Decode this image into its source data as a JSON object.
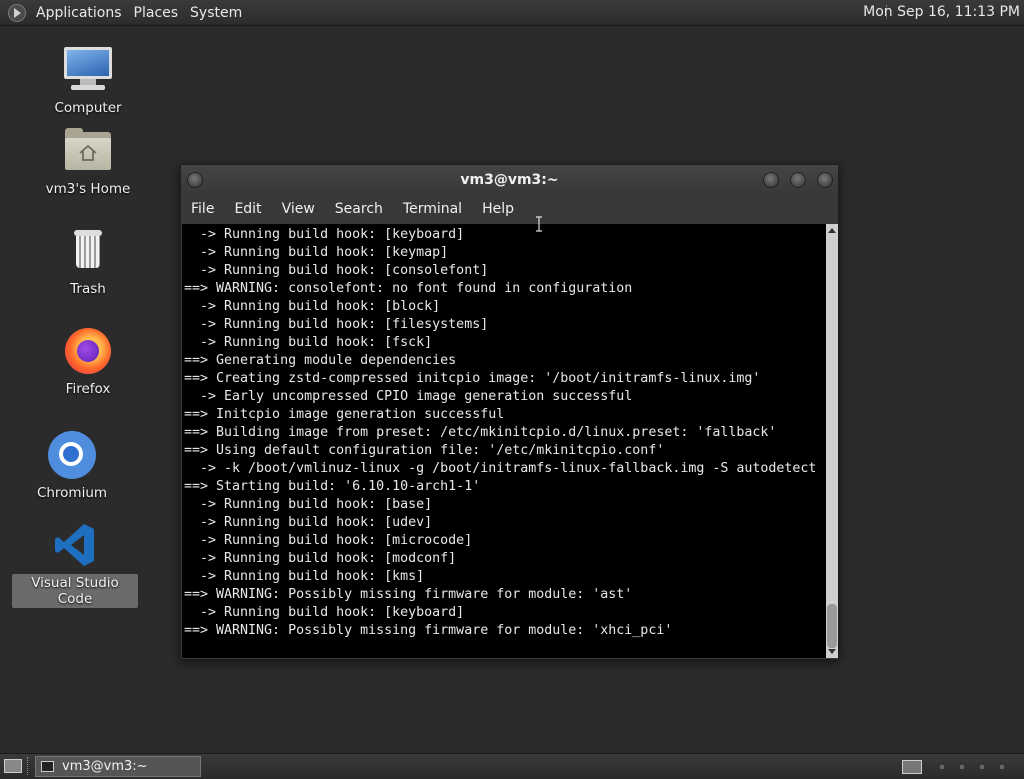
{
  "top_panel": {
    "menus": [
      "Applications",
      "Places",
      "System"
    ],
    "clock": "Mon Sep 16, 11:13 PM"
  },
  "desktop_icons": [
    {
      "label": "Computer",
      "icon": "computer-icon"
    },
    {
      "label": "vm3's Home",
      "icon": "home-folder-icon"
    },
    {
      "label": "Trash",
      "icon": "trash-icon"
    },
    {
      "label": "Firefox",
      "icon": "firefox-icon"
    },
    {
      "label": "Chromium",
      "icon": "chromium-icon"
    },
    {
      "label": "Visual Studio Code",
      "icon": "vscode-icon",
      "selected": true
    }
  ],
  "terminal": {
    "title": "vm3@vm3:~",
    "menu": [
      "File",
      "Edit",
      "View",
      "Search",
      "Terminal",
      "Help"
    ],
    "lines": [
      "  -> Running build hook: [keyboard]",
      "  -> Running build hook: [keymap]",
      "  -> Running build hook: [consolefont]",
      "==> WARNING: consolefont: no font found in configuration",
      "  -> Running build hook: [block]",
      "  -> Running build hook: [filesystems]",
      "  -> Running build hook: [fsck]",
      "==> Generating module dependencies",
      "==> Creating zstd-compressed initcpio image: '/boot/initramfs-linux.img'",
      "  -> Early uncompressed CPIO image generation successful",
      "==> Initcpio image generation successful",
      "==> Building image from preset: /etc/mkinitcpio.d/linux.preset: 'fallback'",
      "==> Using default configuration file: '/etc/mkinitcpio.conf'",
      "  -> -k /boot/vmlinuz-linux -g /boot/initramfs-linux-fallback.img -S autodetect",
      "==> Starting build: '6.10.10-arch1-1'",
      "  -> Running build hook: [base]",
      "  -> Running build hook: [udev]",
      "  -> Running build hook: [microcode]",
      "  -> Running build hook: [modconf]",
      "  -> Running build hook: [kms]",
      "==> WARNING: Possibly missing firmware for module: 'ast'",
      "  -> Running build hook: [keyboard]",
      "==> WARNING: Possibly missing firmware for module: 'xhci_pci'"
    ]
  },
  "taskbar": {
    "window_button": "vm3@vm3:~"
  },
  "colors": {
    "desktop_bg": "#2b2b2b",
    "terminal_bg": "#000000",
    "terminal_fg": "#e8e8e8"
  }
}
